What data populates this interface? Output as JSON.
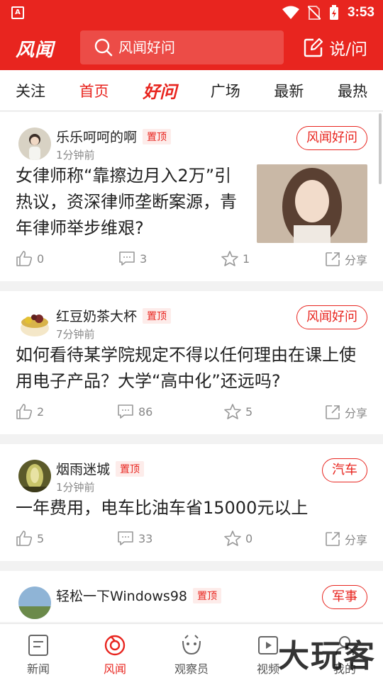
{
  "status_bar": {
    "time": "3:53",
    "app_badge": "A"
  },
  "header": {
    "logo": "风闻",
    "search_placeholder": "风闻好问",
    "ask_label": "说/问"
  },
  "tabs": [
    {
      "label": "关注"
    },
    {
      "label": "首页"
    },
    {
      "label": "好问"
    },
    {
      "label": "广场"
    },
    {
      "label": "最新"
    },
    {
      "label": "最热"
    }
  ],
  "pin_label": "置顶",
  "share_label": "分享",
  "posts": [
    {
      "author": "乐乐呵呵的啊",
      "time": "1分钟前",
      "category": "风闻好问",
      "title": "女律师称“靠擦边月入2万”引热议，资深律师垄断案源，青年律师举步维艰?",
      "likes": "0",
      "comments": "3",
      "favorites": "1"
    },
    {
      "author": "红豆奶茶大杯",
      "time": "7分钟前",
      "category": "风闻好问",
      "title": "如何看待某学院规定不得以任何理由在课上使用电子产品？大学“高中化”还远吗?",
      "likes": "2",
      "comments": "86",
      "favorites": "5"
    },
    {
      "author": "烟雨迷城",
      "time": "1分钟前",
      "category": "汽车",
      "title": "一年费用，电车比油车省15000元以上",
      "likes": "5",
      "comments": "33",
      "favorites": "0"
    },
    {
      "author": "轻松一下Windows98",
      "time": "",
      "category": "军事",
      "title": "",
      "likes": "",
      "comments": "",
      "favorites": ""
    }
  ],
  "bottom_nav": [
    {
      "label": "新闻"
    },
    {
      "label": "风闻"
    },
    {
      "label": "观察员"
    },
    {
      "label": "视频"
    },
    {
      "label": "我的"
    }
  ],
  "watermark": "大玩客",
  "colors": {
    "brand": "#e8251f",
    "text": "#222222",
    "muted": "#888888"
  }
}
